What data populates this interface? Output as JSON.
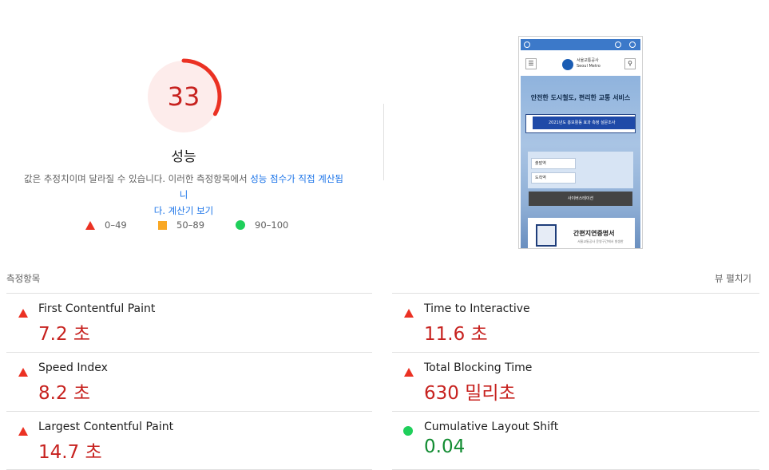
{
  "score": {
    "value": "33",
    "fraction": 0.33,
    "color": "#eb3123",
    "title": "성능",
    "desc_prefix": "값은 추정치이며 달라질 수 있습니다. 이러한 측정항목에서 ",
    "desc_link1": "성능 점수가 직접 계산됩니",
    "desc_link1b": "다.",
    "desc_link2": "계산기 보기"
  },
  "legend": [
    {
      "label": "0–49",
      "shape": "triangle",
      "color": "#eb3123"
    },
    {
      "label": "50–89",
      "shape": "square",
      "color": "#f9a825"
    },
    {
      "label": "90–100",
      "shape": "circle",
      "color": "#1fcf5b"
    }
  ],
  "screenshot": {
    "logo_line1": "서울교통공사",
    "logo_line2": "Seoul Metro",
    "hero_title": "안전한 도시철도, 편리한 교통 서비스",
    "banner_text": "2021년도 홍보활동 효과 측정 설문조사",
    "input1": "출발역",
    "input2": "도착역",
    "dark_button": "사이버스테이션",
    "card_title": "간편지연증명서",
    "card_sub": "서울교통공사 운영구간에서 발생한"
  },
  "metrics": {
    "section_label": "측정항목",
    "expand_label": "뷰 펼치기",
    "items": [
      {
        "title": "First Contentful Paint",
        "value": "7.2 초",
        "status": "poor"
      },
      {
        "title": "Time to Interactive",
        "value": "11.6 초",
        "status": "poor"
      },
      {
        "title": "Speed Index",
        "value": "8.2 초",
        "status": "poor"
      },
      {
        "title": "Total Blocking Time",
        "value": "630 밀리초",
        "status": "poor"
      },
      {
        "title": "Largest Contentful Paint",
        "value": "14.7 초",
        "status": "poor"
      },
      {
        "title": "Cumulative Layout Shift",
        "value": "0.04",
        "status": "good"
      }
    ]
  },
  "colors": {
    "poor": "#eb3123",
    "poor_text": "#c7221f",
    "good": "#1fcf5b",
    "good_text": "#128c32",
    "link": "#1a73e8"
  }
}
